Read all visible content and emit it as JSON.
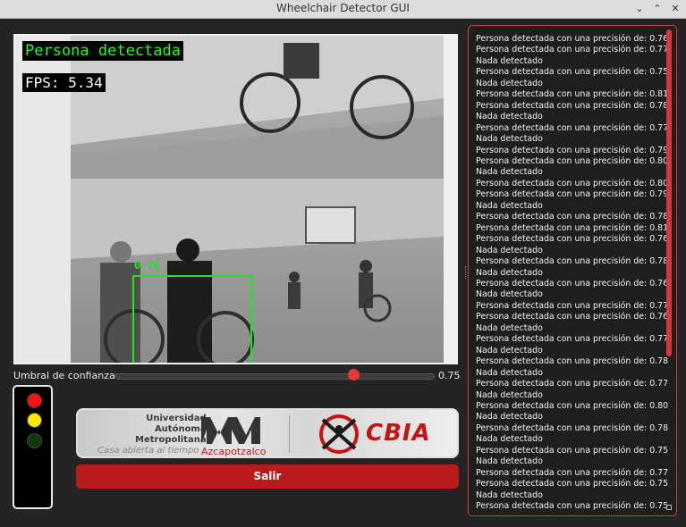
{
  "window": {
    "title": "Wheelchair Detector GUI"
  },
  "video": {
    "status_text": "Persona detectada",
    "fps_text": "FPS: 5.34",
    "detection_label": "0.76"
  },
  "threshold": {
    "label": "Umbral de confianza:",
    "value": 0.75,
    "value_text": "0.75",
    "min": 0,
    "max": 1
  },
  "traffic_light": {
    "colors": {
      "red": "#ff1010",
      "yellow": "#ffeb00",
      "green": "#0d3a0d"
    },
    "active": [
      "red",
      "yellow"
    ]
  },
  "logo": {
    "university_lines": [
      "Universidad",
      "Autónoma",
      "Metropolitana"
    ],
    "motto": "Casa abierta al tiempo",
    "campus": "Azcapotzalco",
    "lab": "CBIA"
  },
  "exit_button": {
    "label": "Salir"
  },
  "colors": {
    "accent": "#d33b3b",
    "button": "#b71b1b",
    "detection": "#1ce81c"
  },
  "log": [
    "Persona detectada con una precisión de: 0.76",
    "Persona detectada con una precisión de: 0.77",
    "Nada detectado",
    "Persona detectada con una precisión de: 0.75",
    "Nada detectado",
    "Persona detectada con una precisión de: 0.81",
    "Persona detectada con una precisión de: 0.78",
    "Nada detectado",
    "Persona detectada con una precisión de: 0.77",
    "Nada detectado",
    "Persona detectada con una precisión de: 0.79",
    "Persona detectada con una precisión de: 0.80",
    "Nada detectado",
    "Persona detectada con una precisión de: 0.80",
    "Persona detectada con una precisión de: 0.79",
    "Nada detectado",
    "Persona detectada con una precisión de: 0.78",
    "Persona detectada con una precisión de: 0.81",
    "Persona detectada con una precisión de: 0.76",
    "Nada detectado",
    "Persona detectada con una precisión de: 0.78",
    "Nada detectado",
    "Persona detectada con una precisión de: 0.76",
    "Nada detectado",
    "Persona detectada con una precisión de: 0.77",
    "Persona detectada con una precisión de: 0.76",
    "Nada detectado",
    "Persona detectada con una precisión de: 0.77",
    "Nada detectado",
    "Persona detectada con una precisión de: 0.78",
    "Nada detectado",
    "Persona detectada con una precisión de: 0.77",
    "Nada detectado",
    "Persona detectada con una precisión de: 0.80",
    "Nada detectado",
    "Persona detectada con una precisión de: 0.78",
    "Nada detectado",
    "Persona detectada con una precisión de: 0.75",
    "Nada detectado",
    "Persona detectada con una precisión de: 0.77",
    "Persona detectada con una precisión de: 0.75",
    "Nada detectado",
    "Persona detectada con una precisión de: 0.75"
  ]
}
